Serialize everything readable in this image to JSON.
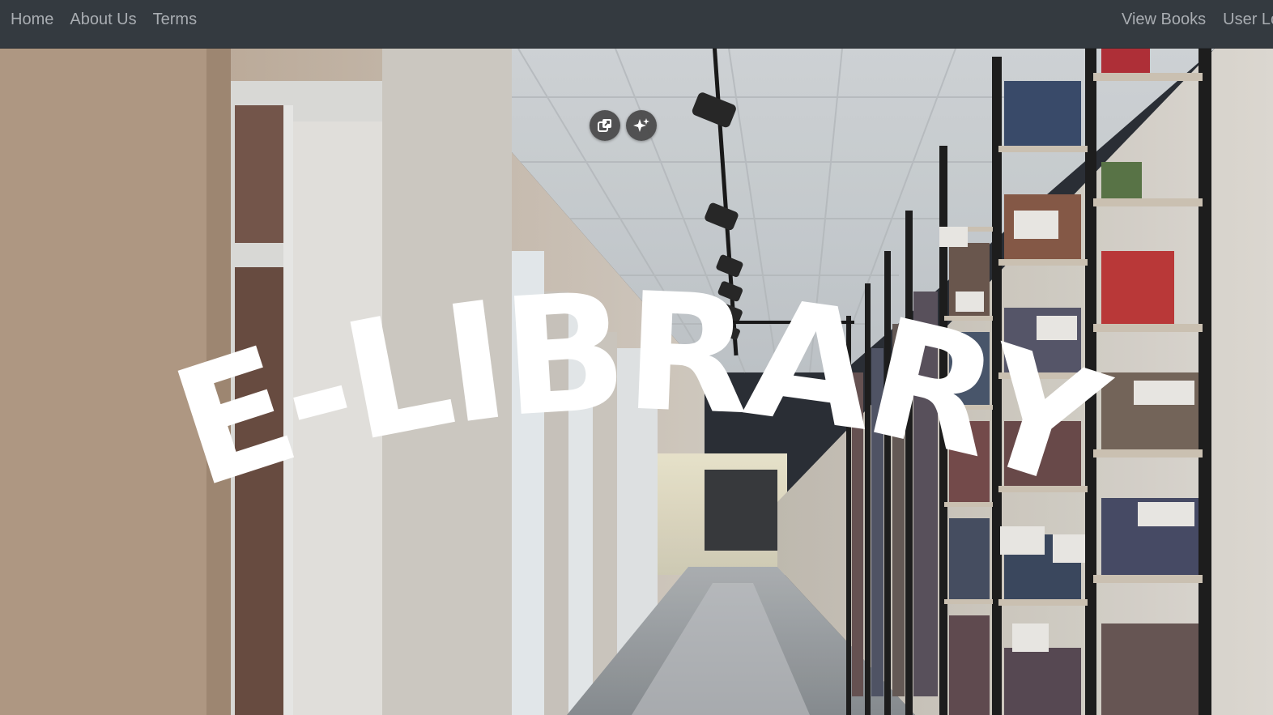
{
  "nav": {
    "left": [
      {
        "label": "Home"
      },
      {
        "label": "About Us"
      },
      {
        "label": "Terms"
      }
    ],
    "right": [
      {
        "label": "View Books"
      },
      {
        "label": "User Lo"
      }
    ]
  },
  "hero": {
    "title": "E-LIBRARY",
    "background": "library-corridor-photo",
    "buttons": [
      {
        "icon": "copy-image-icon"
      },
      {
        "icon": "sparkle-icon"
      }
    ]
  },
  "colors": {
    "navbar": "#343a40",
    "nav_link": "#a9adb2",
    "title": "#ffffff"
  }
}
